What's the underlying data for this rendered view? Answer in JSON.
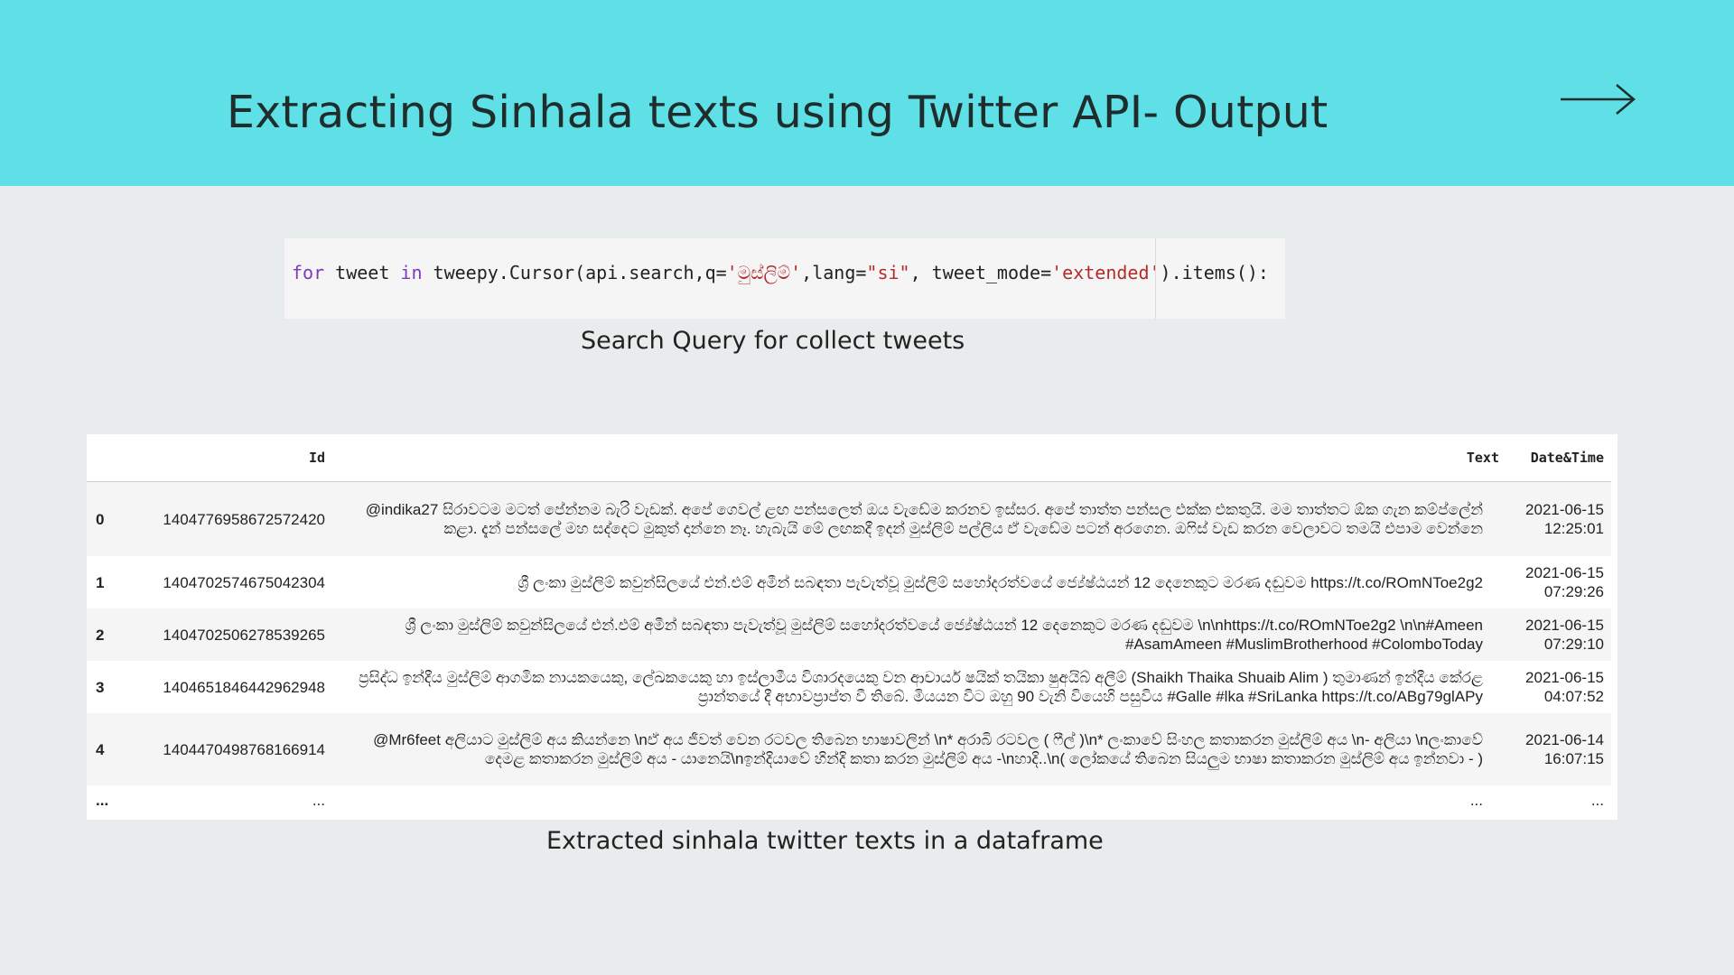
{
  "slide": {
    "title": "Extracting Sinhala texts using Twitter API- Output",
    "next_icon": "arrow-right-icon"
  },
  "code": {
    "kw_for": "for",
    "var_tweet": " tweet ",
    "kw_in": "in",
    "call_start": " tweepy.Cursor(api.search,q=",
    "query_str": "'මුස්ලිම්'",
    "lang_param": ",lang=",
    "lang_str": "\"si\"",
    "mode_param": ", tweet_mode=",
    "mode_str": "'extended'",
    "call_end": ").items():",
    "caption": "Search Query for collect tweets"
  },
  "dataframe": {
    "columns": [
      "",
      "Id",
      "Text",
      "Date&Time"
    ],
    "rows": [
      {
        "index": "0",
        "id": "1404776958672572420",
        "text": "@indika27 සිරාවටම මටත් පේන්නම බැරි වැඩක්. අපේ ගෙවල් ළඟ පන්සලෙත් ඔය වැඩේම කරනව ඉස්සර. අපේ තාත්ත පන්සල එක්ක එකතුයි. මම තාත්තට ඕක ගැන කම්ප්ලේන් කළා. දැන් පන්සලේ මහ සද්දෙට මුකුත් දාන්නෙ නෑ. හැබැයි මේ ලඟකදී ඉදන් මුස්ලිම් පල්ලිය ඒ වැඩේම පටන් අරගෙන. ඔෆිස් වැඩ කරන වෙලාවට තමයි එපාම වෙන්නෙ",
        "datetime": "2021-06-15 12:25:01"
      },
      {
        "index": "1",
        "id": "1404702574675042304",
        "text": "ශ්‍රී ලංකා මුස්ලිම් කවුන්සිලයේ එන්.එම් අමීන් සබඳතා පැවැත්වූ මුස්ලිම් සහෝදරත්වයේ ජ්‍යේෂ්ඨයන් 12 දෙනෙකුට මරණ දඬුවම https://t.co/ROmNToe2g2",
        "datetime": "2021-06-15 07:29:26"
      },
      {
        "index": "2",
        "id": "1404702506278539265",
        "text": "ශ්‍රී ලංකා මුස්ලිම් කවුන්සිලයේ එන්.එම් අමීන් සබඳතා පැවැත්වූ මුස්ලිම් සහෝදරත්වයේ ජ්‍යේෂ්ඨයන් 12 දෙනෙකුට මරණ දඬුවම \\n\\nhttps://t.co/ROmNToe2g2 \\n\\n#Ameen #AsamAmeen #MuslimBrotherhood #ColomboToday",
        "datetime": "2021-06-15 07:29:10"
      },
      {
        "index": "3",
        "id": "1404651846442962948",
        "text": "ප්‍රසිද්ධ ඉන්දීය මුස්ලිම් ආගමික නායකයෙකු, ලේඛකයෙකු හා ඉස්ලාමීය විශාරදයෙකු වන ආචාර්ය ෂයික් තයිකා ෂුඅයිබ් අලීම් (Shaikh Thaika Shuaib Alim ) තුමාණන් ඉන්දීය කේරළ ප්‍රාන්තයේ දී අභාවප්‍රාප්ත වී තිබේ. මියයන විට ඔහු 90 වැනි වියෙහි පසුවිය #Galle #lka #SriLanka https://t.co/ABg79glAPy",
        "datetime": "2021-06-15 04:07:52"
      },
      {
        "index": "4",
        "id": "1404470498768166914",
        "text": "@Mr6feet අලියාට මුස්ලිම් අය කියන්නෙ \\nඒ අය ජීවත් වෙන රටවල තිබෙන භාෂාවලින් \\n* අරාබි රටවල ( ෆීල් )\\n* ලංකාවේ සිංහල කතාකරන මුස්ලිම් අය \\n- අලියා \\nලංකාවේ දෙමළ කතාකරන මුස්ලිම් අය - යානෙයි\\nඉන්දියාවේ හින්දි කතා කරන මුස්ලිම් අය -\\nහාදි..\\n( ලෝකයේ තිබෙන සියලුම භාෂා කතාකරන මුස්ලිම් අය ඉන්නවා - )",
        "datetime": "2021-06-14 16:07:15"
      },
      {
        "index": "...",
        "id": "...",
        "text": "...",
        "datetime": "..."
      }
    ],
    "caption": "Extracted sinhala twitter texts in a dataframe"
  }
}
